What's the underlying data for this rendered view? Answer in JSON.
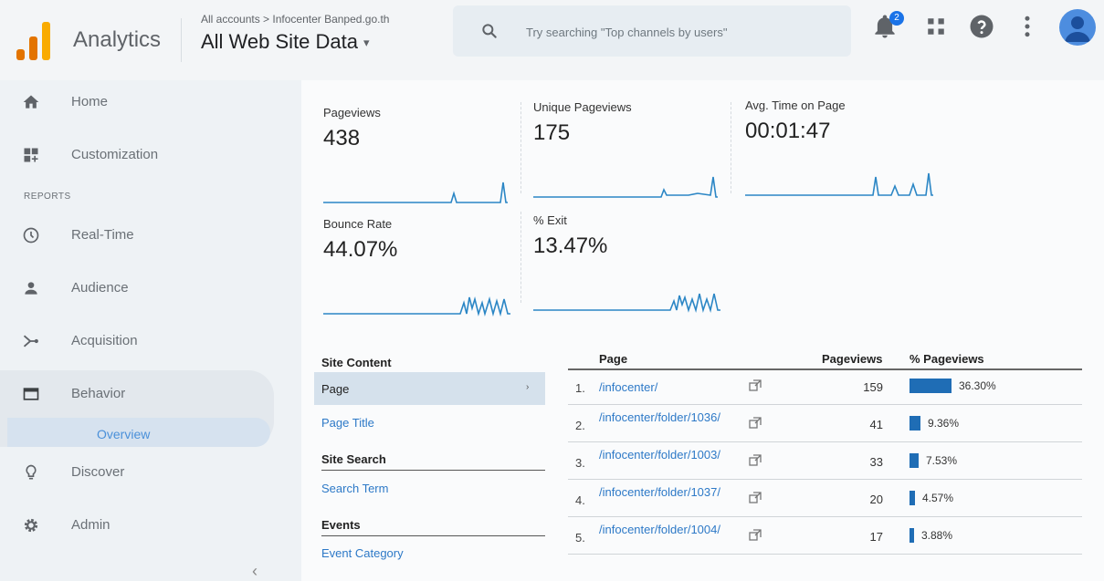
{
  "header": {
    "brand": "Analytics",
    "breadcrumb": "All accounts > Infocenter Banped.go.th",
    "property": "All Web Site Data",
    "property_caret": "▾",
    "search_placeholder": "Try searching \"Top channels by users\"",
    "notification_count": "2",
    "icons": [
      "search-icon",
      "bell-icon",
      "apps-grid-icon",
      "help-icon",
      "more-vert-icon",
      "avatar-icon"
    ],
    "logo_colors": [
      "#f9ab00",
      "#e37400",
      "#e37400"
    ]
  },
  "sidebar": {
    "items": [
      {
        "label": "Home",
        "icon": "home-icon"
      },
      {
        "label": "Customization",
        "icon": "dashboard-icon"
      },
      {
        "label": "Real-Time",
        "icon": "clock-icon"
      },
      {
        "label": "Audience",
        "icon": "person-icon"
      },
      {
        "label": "Acquisition",
        "icon": "acquisition-icon"
      },
      {
        "label": "Behavior",
        "icon": "behavior-icon"
      },
      {
        "label": "Discover",
        "icon": "lightbulb-icon"
      },
      {
        "label": "Admin",
        "icon": "gear-icon"
      }
    ],
    "section_reports": "REPORTS",
    "behavior_sub": "Overview",
    "collapse": "‹"
  },
  "metrics": [
    {
      "label": "Pageviews",
      "value": "438"
    },
    {
      "label": "Unique Pageviews",
      "value": "175"
    },
    {
      "label": "Avg. Time on Page",
      "value": "00:01:47"
    },
    {
      "label": "Bounce Rate",
      "value": "44.07%"
    },
    {
      "label": "% Exit",
      "value": "13.47%"
    }
  ],
  "site_content": {
    "heading": "Site Content",
    "active": "Page",
    "active_arrow": "›",
    "page_title": "Page Title",
    "site_search_heading": "Site Search",
    "search_term": "Search Term",
    "events_heading": "Events",
    "event_category": "Event Category"
  },
  "table": {
    "headers": {
      "page": "Page",
      "pageviews": "Pageviews",
      "pct": "% Pageviews"
    },
    "rows": [
      {
        "num": "1.",
        "page": "/infocenter/",
        "pageviews": "159",
        "pct": "36.30%",
        "share": 36.3
      },
      {
        "num": "2.",
        "page": "/infocenter/folder/1036/",
        "pageviews": "41",
        "pct": "9.36%",
        "share": 9.36
      },
      {
        "num": "3.",
        "page": "/infocenter/folder/1003/",
        "pageviews": "33",
        "pct": "7.53%",
        "share": 7.53
      },
      {
        "num": "4.",
        "page": "/infocenter/folder/1037/",
        "pageviews": "20",
        "pct": "4.57%",
        "share": 4.57
      },
      {
        "num": "5.",
        "page": "/infocenter/folder/1004/",
        "pageviews": "17",
        "pct": "3.88%",
        "share": 3.88
      }
    ]
  },
  "colors": {
    "accent": "#1a73e8",
    "sparkline": "#2b86c5",
    "bar": "#1f6db5",
    "link": "#2d79c7"
  }
}
